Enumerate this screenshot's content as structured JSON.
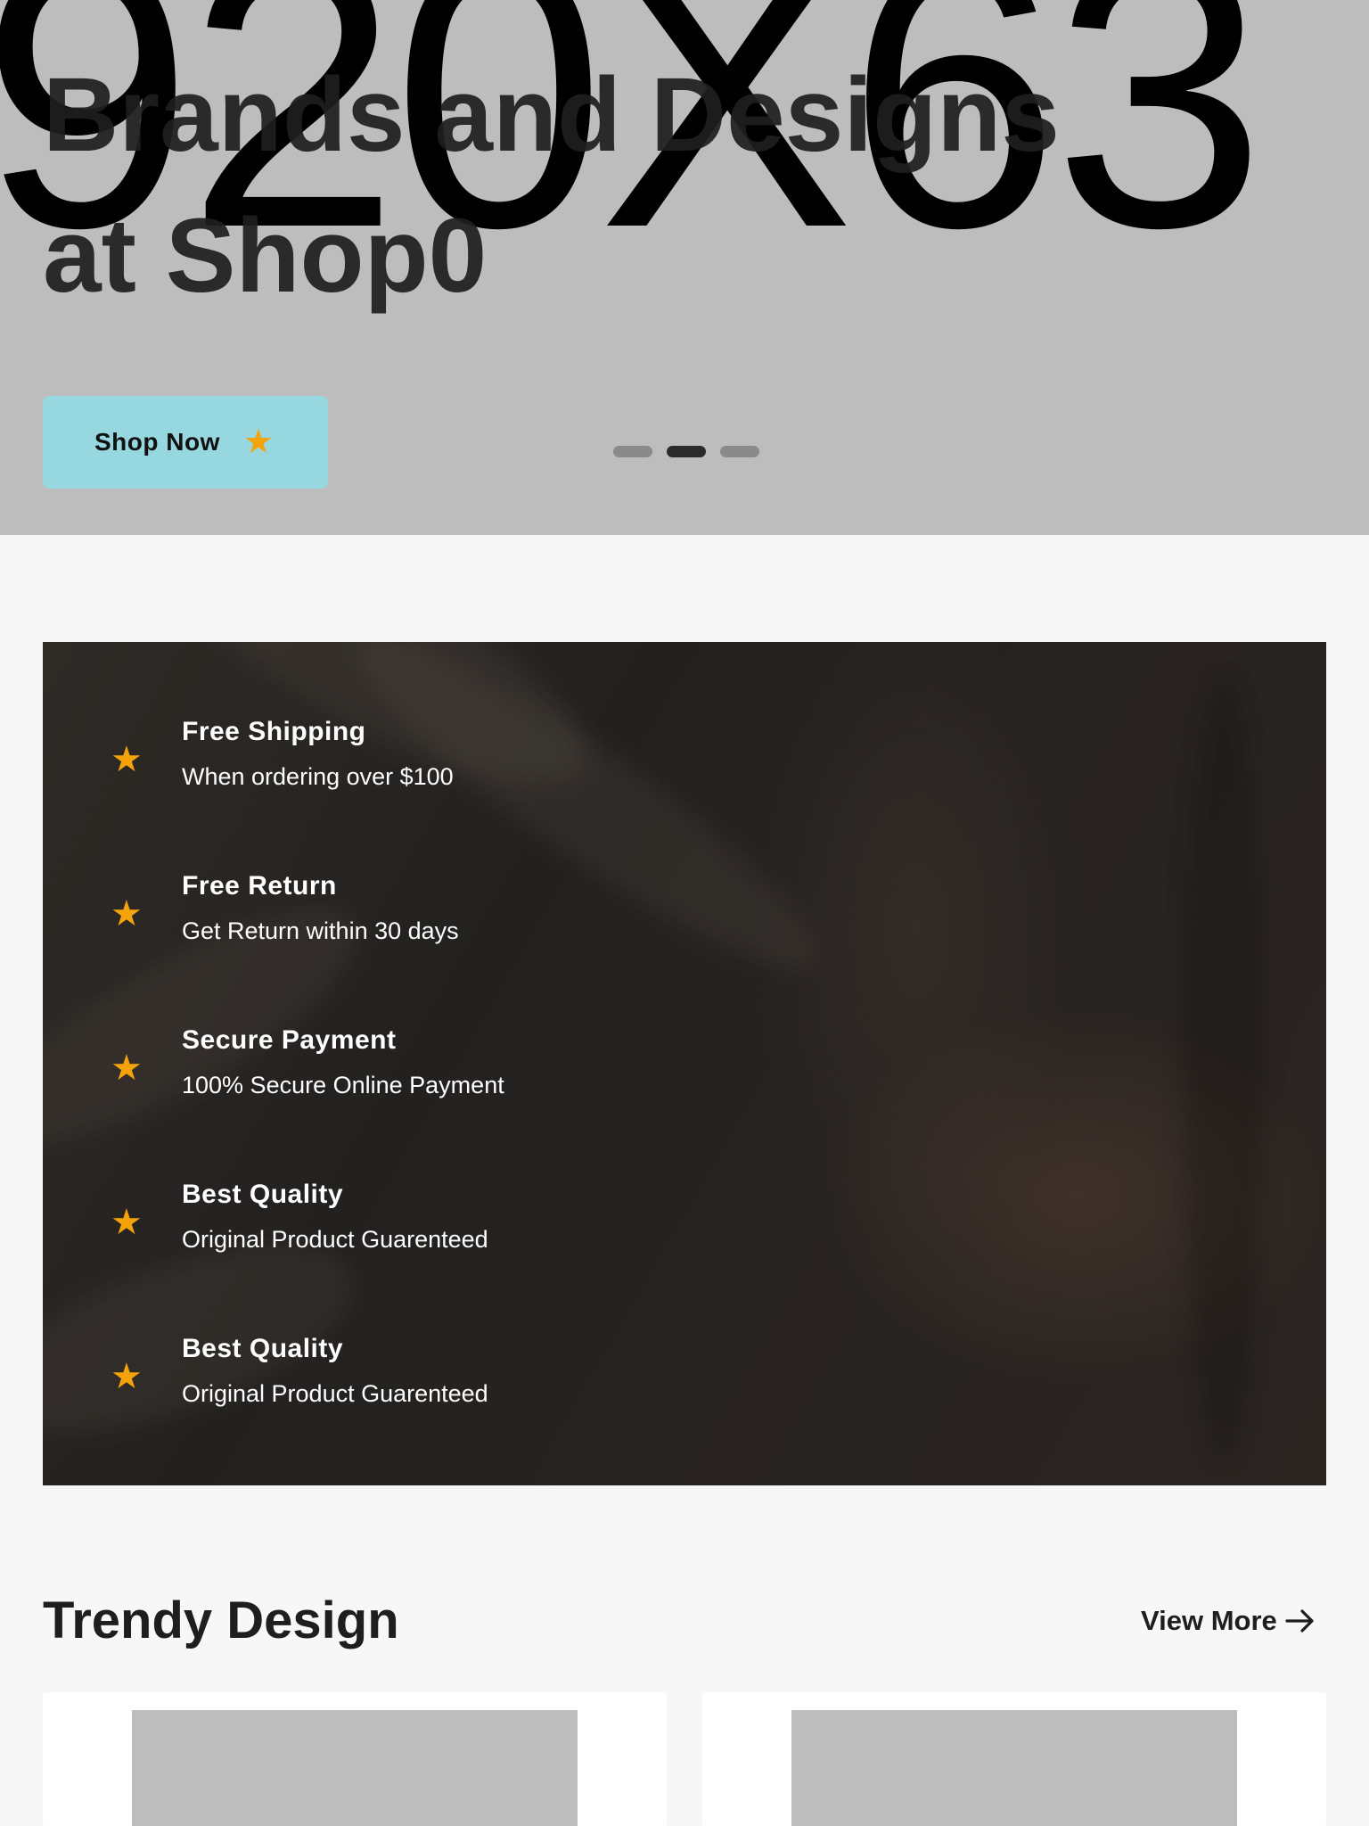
{
  "hero": {
    "watermark_text": "920X63",
    "title_line1": "Brands and Designs",
    "title_line2": "at Shop0",
    "button_label": "Shop Now",
    "button_icon": "star-icon",
    "slider_dots": 3,
    "active_dot": 2
  },
  "features": {
    "items": [
      {
        "title": "Free Shipping",
        "description": "When ordering over $100",
        "icon": "star-icon"
      },
      {
        "title": "Free Return",
        "description": "Get Return within 30 days",
        "icon": "star-icon"
      },
      {
        "title": "Secure Payment",
        "description": "100% Secure Online Payment",
        "icon": "star-icon"
      },
      {
        "title": "Best Quality",
        "description": "Original Product Guarenteed",
        "icon": "star-icon"
      },
      {
        "title": "Best Quality",
        "description": "Original Product Guarenteed",
        "icon": "star-icon"
      }
    ]
  },
  "trendy": {
    "title": "Trendy Design",
    "view_more_label": "View More",
    "view_more_icon": "arrow-right-icon"
  },
  "colors": {
    "hero_bg": "#bdbdbd",
    "button_bg": "#97d8e0",
    "accent_star": "#f5a30b",
    "page_bg": "#f7f7f7",
    "placeholder": "#bdbdbd"
  }
}
